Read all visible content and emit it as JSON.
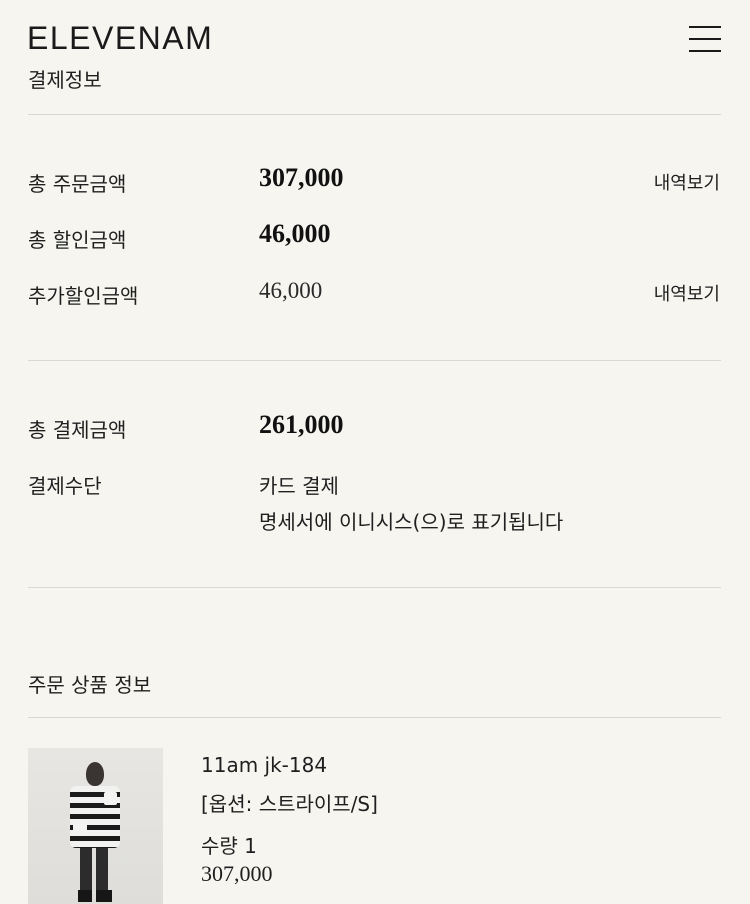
{
  "header": {
    "logo": "ELEVENAM"
  },
  "payment": {
    "title": "결제정보",
    "rows": [
      {
        "label": "총 주문금액",
        "value": "307,000",
        "link": "내역보기"
      },
      {
        "label": "총 할인금액",
        "value": "46,000"
      },
      {
        "label": "추가할인금액",
        "value": "46,000",
        "link": "내역보기"
      }
    ],
    "total": {
      "label": "총 결제금액",
      "value": "261,000"
    },
    "method": {
      "label": "결제수단",
      "value": "카드 결제",
      "note": "명세서에 이니시스(으)로 표기됩니다"
    }
  },
  "products": {
    "title": "주문 상품 정보",
    "items": [
      {
        "name": "11am jk-184",
        "option": "[옵션: 스트라이프/S]",
        "quantity": "수량 1",
        "price": "307,000"
      }
    ]
  }
}
